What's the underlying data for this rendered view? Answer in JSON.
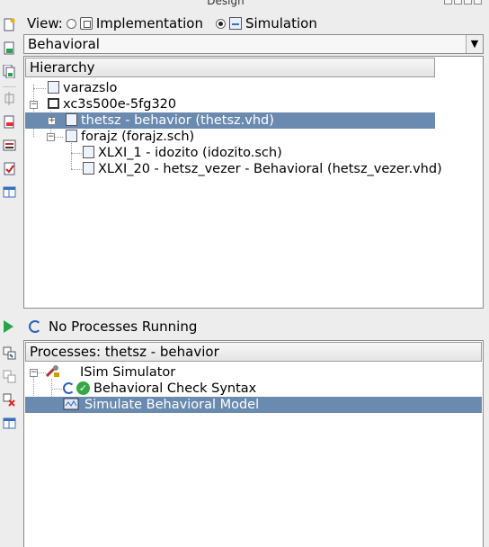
{
  "panel": {
    "title": "Design"
  },
  "view": {
    "label": "View:",
    "options": [
      "Implementation",
      "Simulation"
    ],
    "selected": "Simulation"
  },
  "combo": {
    "selected": "Behavioral"
  },
  "hierarchy": {
    "header": "Hierarchy",
    "items": [
      {
        "label": "varazslo",
        "icon": "source-file-icon"
      },
      {
        "label": "xc3s500e-5fg320",
        "icon": "chip-icon"
      },
      {
        "label": "thetsz - behavior (thetsz.vhd)",
        "icon": "vhdl-file-icon",
        "selected": true
      },
      {
        "label": "forajz (forajz.sch)",
        "icon": "schematic-icon"
      },
      {
        "label": "XLXI_1 - idozito (idozito.sch)",
        "icon": "schematic-icon"
      },
      {
        "label": "XLXI_20 - hetsz_vezer - Behavioral (hetsz_vezer.vhd)",
        "icon": "vhdl-file-icon"
      }
    ]
  },
  "status": {
    "text": "No Processes Running"
  },
  "processes": {
    "header": "Processes: thetsz - behavior",
    "items": [
      {
        "label": "ISim Simulator",
        "icon": "tool-icon"
      },
      {
        "label": "Behavioral Check Syntax",
        "icon": "check-icon"
      },
      {
        "label": "Simulate Behavioral Model",
        "icon": "isim-icon",
        "selected": true
      }
    ]
  },
  "colors": {
    "selection": "#6a8ab0",
    "check": "#35a845",
    "play": "#2aa44a"
  }
}
